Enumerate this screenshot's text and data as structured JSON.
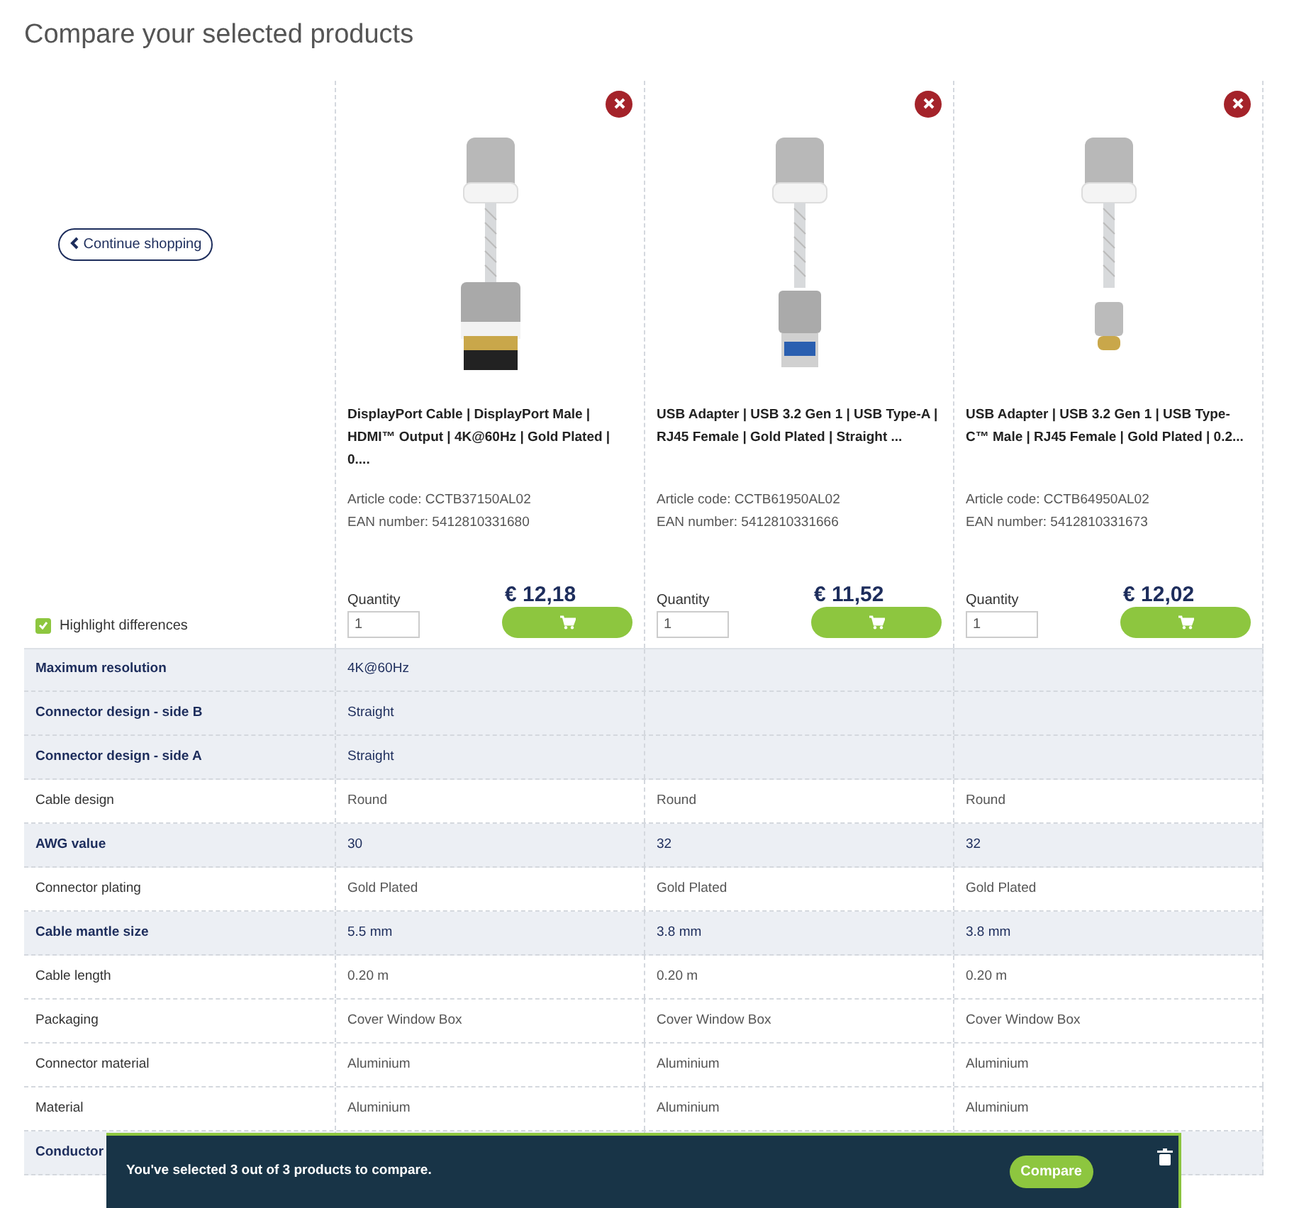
{
  "title": "Compare your selected products",
  "continue_button": "Continue shopping",
  "highlight_differences": {
    "label": "Highlight differences",
    "checked": true
  },
  "products": [
    {
      "kind": "displayport",
      "name": "DisplayPort Cable | DisplayPort Male | HDMI™ Output | 4K@60Hz | Gold Plated | 0....",
      "article_code": "Article code: CCTB37150AL02",
      "ean": "EAN number: 5412810331680",
      "quantity_label": "Quantity",
      "quantity": "1",
      "price": "€ 12,18"
    },
    {
      "kind": "usb-a",
      "name": "USB Adapter | USB 3.2 Gen 1 | USB Type-A | RJ45 Female | Gold Plated | Straight ...",
      "article_code": "Article code: CCTB61950AL02",
      "ean": "EAN number: 5412810331666",
      "quantity_label": "Quantity",
      "quantity": "1",
      "price": "€ 11,52"
    },
    {
      "kind": "usb-c",
      "name": "USB Adapter | USB 3.2 Gen 1 | USB Type-C™ Male | RJ45 Female | Gold Plated | 0.2...",
      "article_code": "Article code: CCTB64950AL02",
      "ean": "EAN number: 5412810331673",
      "quantity_label": "Quantity",
      "quantity": "1",
      "price": "€ 12,02"
    }
  ],
  "rows": [
    {
      "label": "Maximum resolution",
      "values": {
        "product_1": "4K@60Hz"
      },
      "differs": true
    },
    {
      "label": "Connector design - side B",
      "values": {
        "product_1": "Straight"
      },
      "differs": true
    },
    {
      "label": "Connector design - side A",
      "values": {
        "product_1": "Straight"
      },
      "differs": true
    },
    {
      "label": "Cable design",
      "values": {
        "product_1": "Round",
        "product_2": "Round",
        "product_3": "Round"
      }
    },
    {
      "label": "AWG value",
      "values": {
        "product_1": "30",
        "product_2": "32",
        "product_3": "32"
      },
      "differs": true
    },
    {
      "label": "Connector plating",
      "values": {
        "product_1": "Gold Plated",
        "product_2": "Gold Plated",
        "product_3": "Gold Plated"
      }
    },
    {
      "label": "Cable mantle size",
      "values": {
        "product_1": "5.5 mm",
        "product_2": "3.8 mm",
        "product_3": "3.8 mm"
      },
      "differs": true
    },
    {
      "label": "Cable length",
      "values": {
        "product_1": "0.20 m",
        "product_2": "0.20 m",
        "product_3": "0.20 m"
      }
    },
    {
      "label": "Packaging",
      "values": {
        "product_1": "Cover Window Box",
        "product_2": "Cover Window Box",
        "product_3": "Cover Window Box"
      }
    },
    {
      "label": "Connector material",
      "values": {
        "product_1": "Aluminium",
        "product_2": "Aluminium",
        "product_3": "Aluminium"
      }
    },
    {
      "label": "Material",
      "values": {
        "product_1": "Aluminium",
        "product_2": "Aluminium",
        "product_3": "Aluminium"
      }
    },
    {
      "label": "Conductor",
      "differs": true
    }
  ],
  "compare_bar": {
    "message": "You've selected 3 out of 3 products to compare.",
    "compare_button": "Compare"
  }
}
